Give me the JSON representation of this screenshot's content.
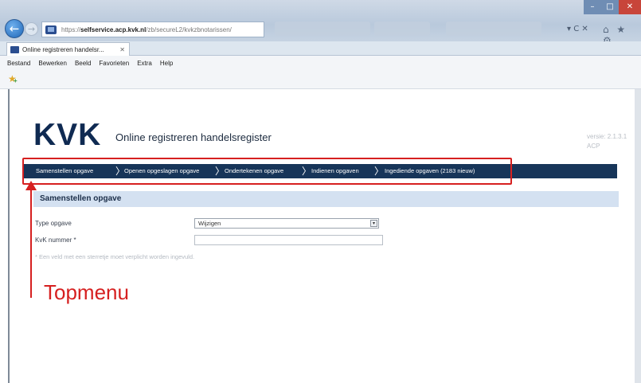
{
  "browser": {
    "url_prefix": "https://",
    "url_host": "selfservice.acp.kvk.nl",
    "url_path": "/zb/secureL2/kvkzbnotarissen/",
    "addr_actions": "▾ C ✕",
    "toolbar_icons": "⌂ ★ ⚙",
    "tab_title": "Online registreren handelsr...",
    "tab_close": "✕",
    "menu": [
      "Bestand",
      "Bewerken",
      "Beeld",
      "Favorieten",
      "Extra",
      "Help"
    ],
    "window_controls": {
      "min": "–",
      "max": "□",
      "close": "✕"
    }
  },
  "header": {
    "logo": "KVK",
    "subtitle": "Online registreren handelsregister",
    "version_line1": "versie: 2.1.3.1",
    "version_line2": "ACP"
  },
  "topnav": {
    "items": [
      "Samenstellen opgave",
      "Openen opgeslagen opgave",
      "Ondertekenen opgave",
      "Indienen opgaven",
      "Ingediende opgaven (2183 nieuw)"
    ]
  },
  "section": {
    "title": "Samenstellen opgave"
  },
  "form": {
    "type_label": "Type opgave",
    "type_value": "Wijzigen",
    "kvk_label": "KvK nummer *",
    "kvk_value": "",
    "footnote": "* Een veld met een sterretje moet verplicht worden ingevuld."
  },
  "annotation": {
    "label": "Topmenu",
    "color": "#d62020"
  },
  "colors": {
    "nav_bg": "#173559",
    "section_bg": "#d4e1f1",
    "logo": "#0f2a52"
  }
}
